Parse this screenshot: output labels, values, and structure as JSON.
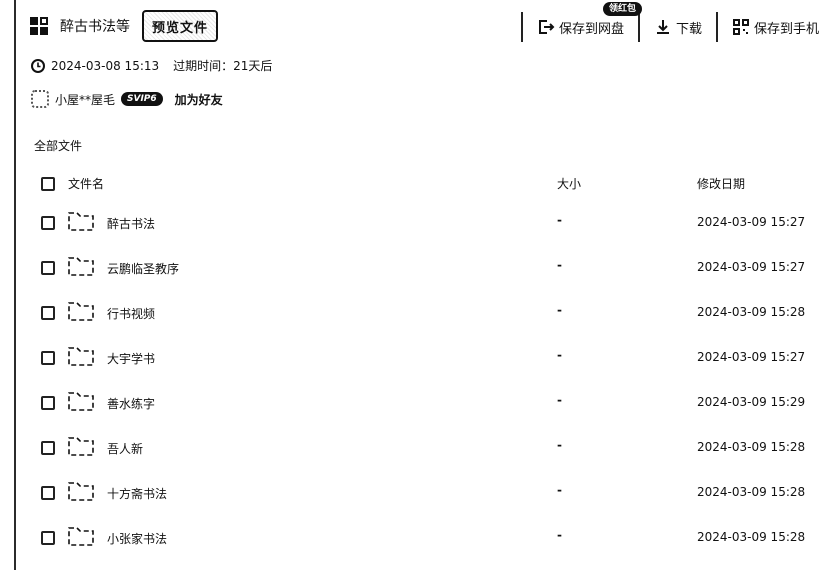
{
  "header": {
    "title": "醉古书法等",
    "stamp": "预览文件"
  },
  "actions": {
    "save_to_disk": "保存到网盘",
    "save_badge": "领红包",
    "download": "下载",
    "save_to_phone": "保存到手机"
  },
  "meta": {
    "created": "2024-03-08 15:13",
    "expire_label": "过期时间：",
    "expire_value": "21天后"
  },
  "user": {
    "name": "小屋**屋毛",
    "vip": "SVIP6",
    "add_friend": "加为好友"
  },
  "breadcrumb": "全部文件",
  "table": {
    "headers": {
      "name": "文件名",
      "size": "大小",
      "modified": "修改日期"
    },
    "rows": [
      {
        "name": "醉古书法",
        "size": "-",
        "modified": "2024-03-09 15:27"
      },
      {
        "name": "云鹏临圣教序",
        "size": "-",
        "modified": "2024-03-09 15:27"
      },
      {
        "name": "行书视频",
        "size": "-",
        "modified": "2024-03-09 15:28"
      },
      {
        "name": "大宇学书",
        "size": "-",
        "modified": "2024-03-09 15:27"
      },
      {
        "name": "善水练字",
        "size": "-",
        "modified": "2024-03-09 15:29"
      },
      {
        "name": "吾人新",
        "size": "-",
        "modified": "2024-03-09 15:28"
      },
      {
        "name": "十方斋书法",
        "size": "-",
        "modified": "2024-03-09 15:28"
      },
      {
        "name": "小张家书法",
        "size": "-",
        "modified": "2024-03-09 15:28"
      }
    ]
  }
}
